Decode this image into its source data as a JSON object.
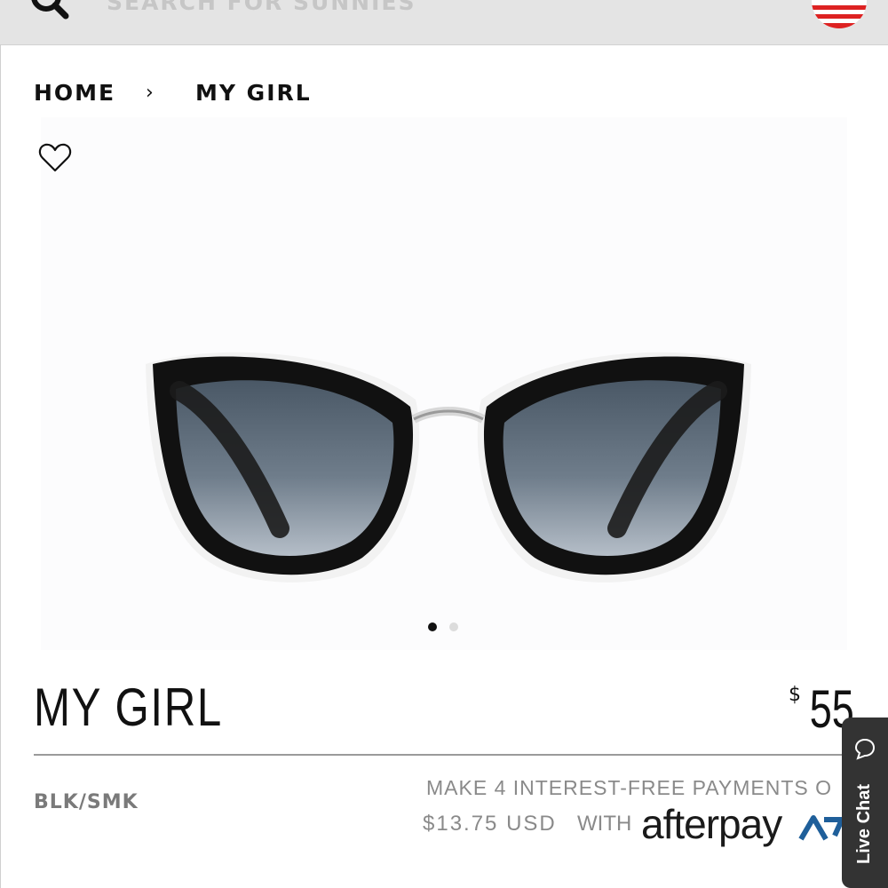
{
  "header": {
    "search_placeholder": "SEARCH FOR SUNNIES",
    "icons": {
      "search": "search-icon",
      "flag": "us-flag-icon"
    }
  },
  "breadcrumb": {
    "home": "HOME",
    "separator": "›",
    "current": "MY GIRL"
  },
  "product": {
    "name": "MY GIRL",
    "price_currency": "$",
    "price": "55",
    "variant": "BLK/SMK",
    "wishlist_icon": "heart-icon",
    "carousel": {
      "total": 2,
      "active": 1
    }
  },
  "afterpay": {
    "line1": "MAKE 4 INTEREST-FREE PAYMENTS O",
    "amount": "$13.75 USD",
    "with_text": "WITH",
    "logo_text": "afterpay"
  },
  "live_chat": {
    "label": "Live Chat"
  },
  "colors": {
    "topbar": "#e4e4e4",
    "text": "#111111",
    "muted": "#8a8a8a",
    "chat_bg": "#333333"
  }
}
